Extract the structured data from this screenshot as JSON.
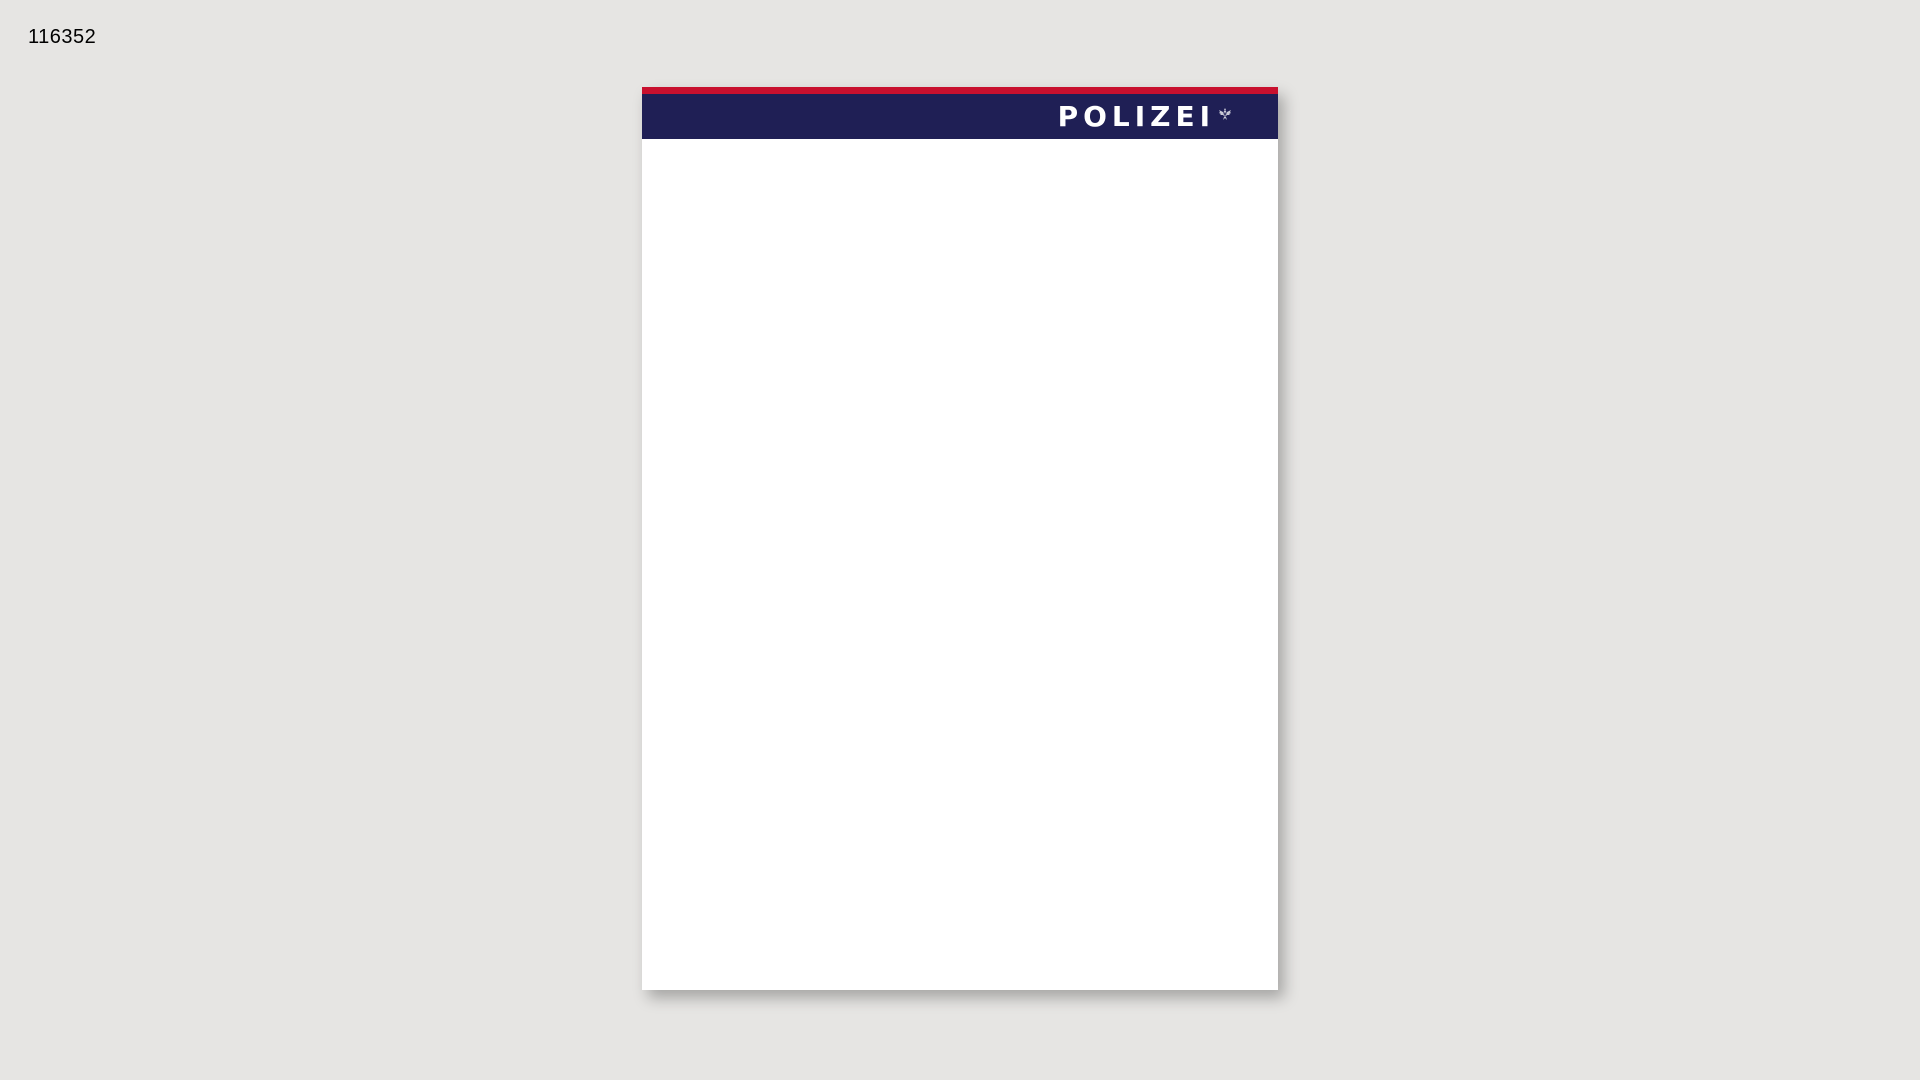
{
  "document": {
    "id_label": "116352"
  },
  "letterhead": {
    "brand_text": "POLIZEI",
    "emblem_icon": "eagle-crest-icon",
    "colors": {
      "stripe": "#c8102e",
      "bar": "#1f1f55",
      "brand_text": "#ffffff",
      "paper": "#ffffff",
      "background": "#e6e5e3"
    }
  }
}
